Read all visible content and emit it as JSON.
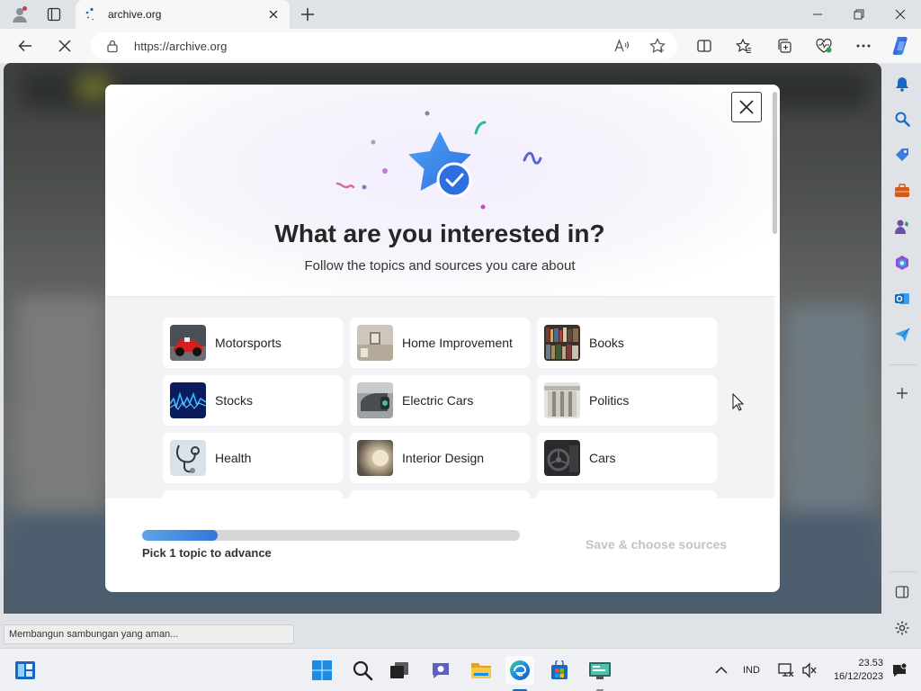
{
  "tab": {
    "title": "archive.org"
  },
  "address_bar": {
    "url": "https://archive.org"
  },
  "modal": {
    "title": "What are you interested in?",
    "subtitle": "Follow the topics and sources you care about",
    "topics": [
      {
        "label": "Motorsports",
        "icon": "motorsports-thumb"
      },
      {
        "label": "Home Improvement",
        "icon": "home-improvement-thumb"
      },
      {
        "label": "Books",
        "icon": "books-thumb"
      },
      {
        "label": "Stocks",
        "icon": "stocks-thumb"
      },
      {
        "label": "Electric Cars",
        "icon": "electric-cars-thumb"
      },
      {
        "label": "Politics",
        "icon": "politics-thumb"
      },
      {
        "label": "Health",
        "icon": "health-thumb"
      },
      {
        "label": "Interior Design",
        "icon": "interior-design-thumb"
      },
      {
        "label": "Cars",
        "icon": "cars-thumb"
      }
    ],
    "progress": {
      "fraction": 0.2,
      "label": "Pick 1 topic to advance"
    },
    "save_button": "Save & choose sources"
  },
  "status_bar": {
    "text": "Membangun sambungan yang aman..."
  },
  "taskbar": {
    "language": "IND",
    "time": "23.53",
    "date": "16/12/2023"
  },
  "colors": {
    "accent": "#2f78d8",
    "disabled_text": "#c2c2c2"
  }
}
